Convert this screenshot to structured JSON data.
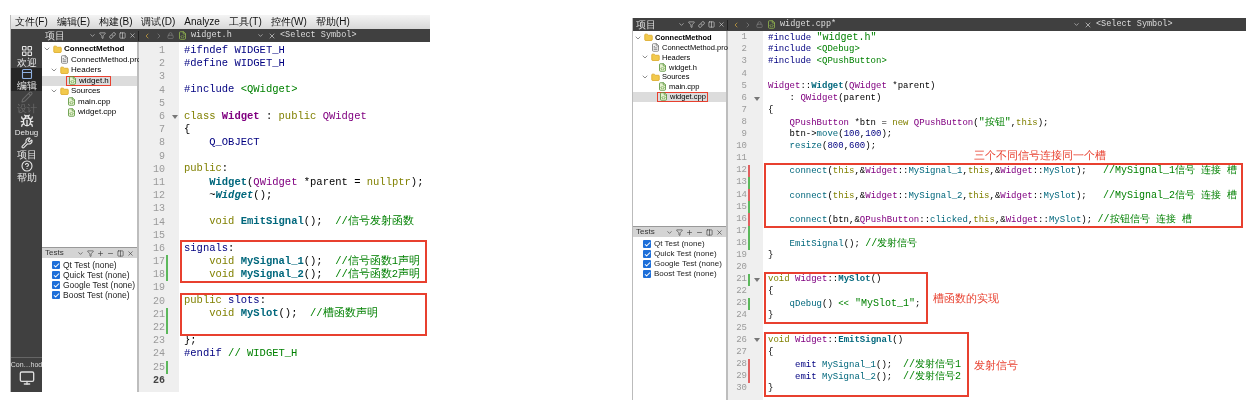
{
  "panels": [
    {
      "menu_bar": [
        "文件(F)",
        "编辑(E)",
        "构建(B)",
        "调试(D)",
        "Analyze",
        "工具(T)",
        "控件(W)",
        "帮助(H)"
      ],
      "mode_bar": {
        "items": [
          {
            "label": "欢迎",
            "kind": "grid",
            "selected": false,
            "disabled": false
          },
          {
            "label": "编辑",
            "kind": "editor",
            "selected": true,
            "disabled": false
          },
          {
            "label": "设计",
            "kind": "pencil",
            "selected": false,
            "disabled": true
          },
          {
            "label": "Debug",
            "kind": "bug",
            "selected": false,
            "disabled": false
          },
          {
            "label": "项目",
            "kind": "wrench",
            "selected": false,
            "disabled": false
          },
          {
            "label": "帮助",
            "kind": "help",
            "selected": false,
            "disabled": false
          }
        ],
        "target": "Con…hod"
      },
      "toolbar": {
        "pane_title": "项目",
        "file": "widget.h",
        "symbol": "<Select Symbol>"
      },
      "tree": [
        {
          "label": "ConnectMethod",
          "kind": "project",
          "expanded": true,
          "selected": false,
          "boxed": false,
          "children": [
            {
              "label": "ConnectMethod.pro",
              "kind": "file",
              "selected": false,
              "boxed": false
            },
            {
              "label": "Headers",
              "kind": "folder",
              "expanded": true,
              "selected": false,
              "boxed": false,
              "children": [
                {
                  "label": "widget.h",
                  "kind": "source",
                  "selected": true,
                  "boxed": true
                }
              ]
            },
            {
              "label": "Sources",
              "kind": "folder",
              "expanded": true,
              "selected": false,
              "boxed": false,
              "children": [
                {
                  "label": "main.cpp",
                  "kind": "source",
                  "selected": false,
                  "boxed": false
                },
                {
                  "label": "widget.cpp",
                  "kind": "source",
                  "selected": false,
                  "boxed": false
                }
              ]
            }
          ]
        }
      ],
      "tests": {
        "title": "Tests",
        "items": [
          {
            "label": "Qt Test (none)",
            "checked": true
          },
          {
            "label": "Quick Test (none)",
            "checked": true
          },
          {
            "label": "Google Test (none)",
            "checked": true
          },
          {
            "label": "Boost Test (none)",
            "checked": true
          }
        ]
      },
      "editor": {
        "segments": [
          {
            "kind": "plain",
            "lines": [
              {
                "number": "1",
                "fold": false,
                "current": false,
                "tokens": [
                  {
                    "kind": "pp",
                    "text": "#ifndef WIDGET_H"
                  }
                ]
              },
              {
                "number": "2",
                "fold": false,
                "current": false,
                "tokens": [
                  {
                    "kind": "pp",
                    "text": "#define WIDGET_H"
                  }
                ]
              },
              {
                "number": "3",
                "fold": false,
                "current": false
              },
              {
                "number": "4",
                "fold": false,
                "current": false,
                "tokens": [
                  {
                    "kind": "pp",
                    "text": "#include "
                  },
                  {
                    "kind": "inc",
                    "text": "<QWidget>"
                  }
                ]
              },
              {
                "number": "5",
                "fold": false,
                "current": false
              },
              {
                "number": "6",
                "fold": true,
                "current": false,
                "tokens": [
                  {
                    "kind": "kw",
                    "text": "class"
                  },
                  {
                    "kind": "typedecl",
                    "text": " Widget"
                  },
                  {
                    "kind": "p",
                    "text": " : "
                  },
                  {
                    "kind": "kw",
                    "text": "public"
                  },
                  {
                    "kind": "type",
                    "text": " QWidget"
                  }
                ]
              },
              {
                "number": "7",
                "fold": false,
                "current": false,
                "tokens": [
                  {
                    "kind": "p",
                    "text": "{"
                  }
                ]
              },
              {
                "number": "8",
                "fold": false,
                "current": false,
                "tokens": [
                  {
                    "kind": "pp",
                    "text": "    Q_OBJECT"
                  }
                ]
              },
              {
                "number": "9",
                "fold": false,
                "current": false
              },
              {
                "number": "10",
                "fold": false,
                "current": false,
                "tokens": [
                  {
                    "kind": "kw",
                    "text": "public"
                  },
                  {
                    "kind": "p",
                    "text": ":"
                  }
                ]
              },
              {
                "number": "11",
                "fold": false,
                "current": false,
                "tokens": [
                  {
                    "kind": "fdecl",
                    "text": "    Widget"
                  },
                  {
                    "kind": "p",
                    "text": "("
                  },
                  {
                    "kind": "type",
                    "text": "QWidget"
                  },
                  {
                    "kind": "p",
                    "text": " *parent = "
                  },
                  {
                    "kind": "kw",
                    "text": "nullptr"
                  },
                  {
                    "kind": "p",
                    "text": ");"
                  }
                ]
              },
              {
                "number": "12",
                "fold": false,
                "current": false,
                "tokens": [
                  {
                    "kind": "p",
                    "text": "    ~"
                  },
                  {
                    "kind": "fvirt",
                    "text": "Widget"
                  },
                  {
                    "kind": "p",
                    "text": "();"
                  }
                ]
              },
              {
                "number": "13",
                "fold": false,
                "current": false
              },
              {
                "number": "14",
                "fold": false,
                "current": false,
                "tokens": [
                  {
                    "kind": "kw",
                    "text": "    void"
                  },
                  {
                    "kind": "fdecl",
                    "text": " EmitSignal"
                  },
                  {
                    "kind": "p",
                    "text": "();  "
                  },
                  {
                    "kind": "cm",
                    "text": "//信号发射函数"
                  }
                ]
              },
              {
                "number": "15",
                "fold": false,
                "current": false
              }
            ]
          },
          {
            "kind": "wide-box",
            "lines": [
              {
                "number": "16",
                "fold": false,
                "current": false,
                "tokens": [
                  {
                    "kind": "pp",
                    "text": "signals"
                  },
                  {
                    "kind": "p",
                    "text": ":"
                  }
                ]
              },
              {
                "number": "17",
                "fold": false,
                "current": false,
                "color": "#5cb85c",
                "tokens": [
                  {
                    "kind": "kw",
                    "text": "    void"
                  },
                  {
                    "kind": "fdecl",
                    "text": " MySignal_1"
                  },
                  {
                    "kind": "p",
                    "text": "();  "
                  },
                  {
                    "kind": "cm",
                    "text": "//信号函数1声明"
                  }
                ]
              },
              {
                "number": "18",
                "fold": false,
                "current": false,
                "color": "#5cb85c",
                "tokens": [
                  {
                    "kind": "kw",
                    "text": "    void"
                  },
                  {
                    "kind": "fdecl",
                    "text": " MySignal_2"
                  },
                  {
                    "kind": "p",
                    "text": "();  "
                  },
                  {
                    "kind": "cm",
                    "text": "//信号函数2声明"
                  }
                ]
              }
            ]
          },
          {
            "kind": "plain",
            "lines": [
              {
                "number": "19",
                "fold": false,
                "current": false
              }
            ]
          },
          {
            "kind": "wide-box",
            "lines": [
              {
                "number": "20",
                "fold": false,
                "current": false,
                "tokens": [
                  {
                    "kind": "kw",
                    "text": "public"
                  },
                  {
                    "kind": "pp",
                    "text": " slots"
                  },
                  {
                    "kind": "p",
                    "text": ":"
                  }
                ]
              },
              {
                "number": "21",
                "fold": false,
                "current": false,
                "color": "#5cb85c",
                "tokens": [
                  {
                    "kind": "kw",
                    "text": "    void"
                  },
                  {
                    "kind": "fdecl",
                    "text": " MySlot"
                  },
                  {
                    "kind": "p",
                    "text": "();  "
                  },
                  {
                    "kind": "cm",
                    "text": "//槽函数声明"
                  }
                ]
              },
              {
                "number": "22",
                "fold": false,
                "current": false,
                "color": "#5cb85c"
              }
            ]
          },
          {
            "kind": "plain",
            "lines": [
              {
                "number": "23",
                "fold": false,
                "current": false,
                "tokens": [
                  {
                    "kind": "p",
                    "text": "};"
                  }
                ]
              },
              {
                "number": "24",
                "fold": false,
                "current": false,
                "tokens": [
                  {
                    "kind": "pp",
                    "text": "#endif"
                  },
                  {
                    "kind": "cm",
                    "text": " // WIDGET_H"
                  }
                ]
              },
              {
                "number": "25",
                "fold": false,
                "current": false,
                "color": "#5cb85c"
              },
              {
                "number": "26",
                "fold": false,
                "current": true
              }
            ]
          }
        ]
      }
    },
    {
      "toolbar": {
        "pane_title": "项目",
        "file": "widget.cpp*",
        "symbol": "<Select Symbol>"
      },
      "tree": [
        {
          "label": "ConnectMethod",
          "kind": "project",
          "expanded": true,
          "selected": false,
          "boxed": false,
          "children": [
            {
              "label": "ConnectMethod.pro",
              "kind": "file",
              "selected": false,
              "boxed": false
            },
            {
              "label": "Headers",
              "kind": "folder",
              "expanded": true,
              "selected": false,
              "boxed": false,
              "children": [
                {
                  "label": "widget.h",
                  "kind": "source",
                  "selected": false,
                  "boxed": false
                }
              ]
            },
            {
              "label": "Sources",
              "kind": "folder",
              "expanded": true,
              "selected": false,
              "boxed": false,
              "children": [
                {
                  "label": "main.cpp",
                  "kind": "source",
                  "selected": false,
                  "boxed": false
                },
                {
                  "label": "widget.cpp",
                  "kind": "source",
                  "selected": true,
                  "boxed": true
                }
              ]
            }
          ]
        }
      ],
      "tests": {
        "title": "Tests",
        "items": [
          {
            "label": "Qt Test (none)",
            "checked": true
          },
          {
            "label": "Quick Test (none)",
            "checked": true
          },
          {
            "label": "Google Test (none)",
            "checked": true
          },
          {
            "label": "Boost Test (none)",
            "checked": true
          }
        ]
      },
      "editor": {
        "segments": [
          {
            "kind": "plain",
            "lines": [
              {
                "number": "1",
                "fold": false,
                "current": false,
                "tokens": [
                  {
                    "kind": "pp",
                    "text": "#include "
                  },
                  {
                    "kind": "str",
                    "text": "\"widget.h\""
                  }
                ]
              },
              {
                "number": "2",
                "fold": false,
                "current": false,
                "tokens": [
                  {
                    "kind": "pp",
                    "text": "#include "
                  },
                  {
                    "kind": "inc",
                    "text": "<QDebug>"
                  }
                ]
              },
              {
                "number": "3",
                "fold": false,
                "current": false,
                "tokens": [
                  {
                    "kind": "pp",
                    "text": "#include "
                  },
                  {
                    "kind": "inc",
                    "text": "<QPushButton>"
                  }
                ]
              },
              {
                "number": "4",
                "fold": false,
                "current": false
              },
              {
                "number": "5",
                "fold": false,
                "current": false,
                "tokens": [
                  {
                    "kind": "type",
                    "text": "Widget"
                  },
                  {
                    "kind": "p",
                    "text": "::"
                  },
                  {
                    "kind": "fdecl",
                    "text": "Widget"
                  },
                  {
                    "kind": "p",
                    "text": "("
                  },
                  {
                    "kind": "type",
                    "text": "QWidget"
                  },
                  {
                    "kind": "p",
                    "text": " *parent)"
                  }
                ]
              },
              {
                "number": "6",
                "fold": true,
                "current": false,
                "tokens": [
                  {
                    "kind": "p",
                    "text": "    : "
                  },
                  {
                    "kind": "type",
                    "text": "QWidget"
                  },
                  {
                    "kind": "p",
                    "text": "(parent)"
                  }
                ]
              },
              {
                "number": "7",
                "fold": false,
                "current": false,
                "tokens": [
                  {
                    "kind": "p",
                    "text": "{"
                  }
                ]
              },
              {
                "number": "8",
                "fold": false,
                "current": false,
                "tokens": [
                  {
                    "kind": "type",
                    "text": "    QPushButton"
                  },
                  {
                    "kind": "p",
                    "text": " *btn = "
                  },
                  {
                    "kind": "kw",
                    "text": "new"
                  },
                  {
                    "kind": "type",
                    "text": " QPushButton"
                  },
                  {
                    "kind": "p",
                    "text": "("
                  },
                  {
                    "kind": "str",
                    "text": "\"按钮\""
                  },
                  {
                    "kind": "p",
                    "text": ","
                  },
                  {
                    "kind": "kw",
                    "text": "this"
                  },
                  {
                    "kind": "p",
                    "text": ");"
                  }
                ]
              },
              {
                "number": "9",
                "fold": false,
                "current": false,
                "tokens": [
                  {
                    "kind": "p",
                    "text": "    btn->"
                  },
                  {
                    "kind": "func",
                    "text": "move"
                  },
                  {
                    "kind": "p",
                    "text": "("
                  },
                  {
                    "kind": "num",
                    "text": "100"
                  },
                  {
                    "kind": "p",
                    "text": ","
                  },
                  {
                    "kind": "num",
                    "text": "100"
                  },
                  {
                    "kind": "p",
                    "text": ");"
                  }
                ]
              },
              {
                "number": "10",
                "fold": false,
                "current": false,
                "tokens": [
                  {
                    "kind": "func",
                    "text": "    resize"
                  },
                  {
                    "kind": "p",
                    "text": "("
                  },
                  {
                    "kind": "num",
                    "text": "800"
                  },
                  {
                    "kind": "p",
                    "text": ","
                  },
                  {
                    "kind": "num",
                    "text": "600"
                  },
                  {
                    "kind": "p",
                    "text": ");"
                  }
                ]
              },
              {
                "number": "11",
                "fold": false,
                "current": false
              }
            ]
          },
          {
            "kind": "wide-box",
            "note": "三个不同信号连接同一个槽",
            "lines": [
              {
                "number": "12",
                "fold": false,
                "current": false,
                "color": "#e06060",
                "tokens": [
                  {
                    "kind": "func",
                    "text": "    connect"
                  },
                  {
                    "kind": "p",
                    "text": "("
                  },
                  {
                    "kind": "kw",
                    "text": "this"
                  },
                  {
                    "kind": "p",
                    "text": ",&"
                  },
                  {
                    "kind": "type",
                    "text": "Widget"
                  },
                  {
                    "kind": "p",
                    "text": "::"
                  },
                  {
                    "kind": "func",
                    "text": "MySignal_1"
                  },
                  {
                    "kind": "p",
                    "text": ","
                  },
                  {
                    "kind": "kw",
                    "text": "this"
                  },
                  {
                    "kind": "p",
                    "text": ",&"
                  },
                  {
                    "kind": "type",
                    "text": "Widget"
                  },
                  {
                    "kind": "p",
                    "text": "::"
                  },
                  {
                    "kind": "func",
                    "text": "MySlot"
                  },
                  {
                    "kind": "p",
                    "text": ");   "
                  },
                  {
                    "kind": "cm",
                    "text": "//MySignal_1信号 连接 槽"
                  }
                ]
              },
              {
                "number": "13",
                "fold": false,
                "current": false,
                "color": "#5cb85c"
              },
              {
                "number": "14",
                "fold": false,
                "current": false,
                "color": "#e06060",
                "tokens": [
                  {
                    "kind": "func",
                    "text": "    connect"
                  },
                  {
                    "kind": "p",
                    "text": "("
                  },
                  {
                    "kind": "kw",
                    "text": "this"
                  },
                  {
                    "kind": "p",
                    "text": ",&"
                  },
                  {
                    "kind": "type",
                    "text": "Widget"
                  },
                  {
                    "kind": "p",
                    "text": "::"
                  },
                  {
                    "kind": "func",
                    "text": "MySignal_2"
                  },
                  {
                    "kind": "p",
                    "text": ","
                  },
                  {
                    "kind": "kw",
                    "text": "this"
                  },
                  {
                    "kind": "p",
                    "text": ",&"
                  },
                  {
                    "kind": "type",
                    "text": "Widget"
                  },
                  {
                    "kind": "p",
                    "text": "::"
                  },
                  {
                    "kind": "func",
                    "text": "MySlot"
                  },
                  {
                    "kind": "p",
                    "text": ");   "
                  },
                  {
                    "kind": "cm",
                    "text": "//MySignal_2信号 连接 槽"
                  }
                ]
              },
              {
                "number": "15",
                "fold": false,
                "current": false,
                "color": "#5cb85c"
              },
              {
                "number": "16",
                "fold": false,
                "current": false,
                "color": "#e06060",
                "tokens": [
                  {
                    "kind": "func",
                    "text": "    connect"
                  },
                  {
                    "kind": "p",
                    "text": "(btn,&"
                  },
                  {
                    "kind": "type",
                    "text": "QPushButton"
                  },
                  {
                    "kind": "p",
                    "text": "::"
                  },
                  {
                    "kind": "func",
                    "text": "clicked"
                  },
                  {
                    "kind": "p",
                    "text": ","
                  },
                  {
                    "kind": "kw",
                    "text": "this"
                  },
                  {
                    "kind": "p",
                    "text": ",&"
                  },
                  {
                    "kind": "type",
                    "text": "Widget"
                  },
                  {
                    "kind": "p",
                    "text": "::"
                  },
                  {
                    "kind": "func",
                    "text": "MySlot"
                  },
                  {
                    "kind": "p",
                    "text": "); "
                  },
                  {
                    "kind": "cm",
                    "text": "//按钮信号 连接 槽"
                  }
                ]
              }
            ]
          },
          {
            "kind": "plain",
            "lines": [
              {
                "number": "17",
                "fold": false,
                "current": false,
                "color": "#5cb85c"
              },
              {
                "number": "18",
                "fold": false,
                "current": false,
                "color": "#5cb85c",
                "tokens": [
                  {
                    "kind": "func",
                    "text": "    EmitSignal"
                  },
                  {
                    "kind": "p",
                    "text": "(); "
                  },
                  {
                    "kind": "cm",
                    "text": "//发射信号"
                  }
                ]
              },
              {
                "number": "19",
                "fold": false,
                "current": false,
                "tokens": [
                  {
                    "kind": "p",
                    "text": "}"
                  }
                ]
              },
              {
                "number": "20",
                "fold": false,
                "current": false
              }
            ]
          },
          {
            "kind": "fit-box",
            "note": "槽函数的实现",
            "lines": [
              {
                "number": "21",
                "fold": true,
                "current": false,
                "color": "#5cb85c",
                "tokens": [
                  {
                    "kind": "kw",
                    "text": "void"
                  },
                  {
                    "kind": "type",
                    "text": " Widget"
                  },
                  {
                    "kind": "p",
                    "text": "::"
                  },
                  {
                    "kind": "fdecl",
                    "text": "MySlot"
                  },
                  {
                    "kind": "p",
                    "text": "()"
                  }
                ]
              },
              {
                "number": "22",
                "fold": false,
                "current": false,
                "tokens": [
                  {
                    "kind": "p",
                    "text": "{"
                  }
                ]
              },
              {
                "number": "23",
                "fold": false,
                "current": false,
                "color": "#5cb85c",
                "tokens": [
                  {
                    "kind": "func",
                    "text": "    qDebug"
                  },
                  {
                    "kind": "p",
                    "text": "() "
                  },
                  {
                    "kind": "op",
                    "text": "<<"
                  },
                  {
                    "kind": "str",
                    "text": " \"MySlot_1\""
                  },
                  {
                    "kind": "p",
                    "text": ";"
                  }
                ]
              },
              {
                "number": "24",
                "fold": false,
                "current": false,
                "tokens": [
                  {
                    "kind": "p",
                    "text": "}"
                  }
                ]
              }
            ]
          },
          {
            "kind": "plain",
            "lines": [
              {
                "number": "25",
                "fold": false,
                "current": false
              }
            ]
          },
          {
            "kind": "fit-box",
            "note": "发射信号",
            "lines": [
              {
                "number": "26",
                "fold": true,
                "current": false,
                "tokens": [
                  {
                    "kind": "kw",
                    "text": "void"
                  },
                  {
                    "kind": "type",
                    "text": " Widget"
                  },
                  {
                    "kind": "p",
                    "text": "::"
                  },
                  {
                    "kind": "fdecl",
                    "text": "EmitSignal"
                  },
                  {
                    "kind": "p",
                    "text": "()"
                  }
                ]
              },
              {
                "number": "27",
                "fold": false,
                "current": false,
                "tokens": [
                  {
                    "kind": "p",
                    "text": "{"
                  }
                ]
              },
              {
                "number": "28",
                "fold": false,
                "current": false,
                "color": "#e06060",
                "tokens": [
                  {
                    "kind": "pp",
                    "text": "     emit"
                  },
                  {
                    "kind": "func",
                    "text": " MySignal_1"
                  },
                  {
                    "kind": "p",
                    "text": "();  "
                  },
                  {
                    "kind": "cm",
                    "text": "//发射信号1"
                  }
                ]
              },
              {
                "number": "29",
                "fold": false,
                "current": false,
                "color": "#e06060",
                "tokens": [
                  {
                    "kind": "pp",
                    "text": "     emit"
                  },
                  {
                    "kind": "func",
                    "text": " MySignal_2"
                  },
                  {
                    "kind": "p",
                    "text": "();  "
                  },
                  {
                    "kind": "cm",
                    "text": "//发射信号2"
                  }
                ]
              },
              {
                "number": "30",
                "fold": false,
                "current": false,
                "tokens": [
                  {
                    "kind": "p",
                    "text": "}"
                  }
                ]
              }
            ]
          }
        ]
      }
    }
  ]
}
